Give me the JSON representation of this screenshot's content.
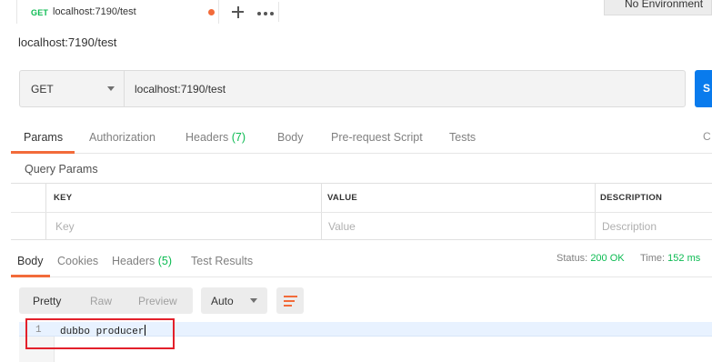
{
  "tab": {
    "method": "GET",
    "name": "localhost:7190/test"
  },
  "environment": {
    "label": "No Environment"
  },
  "request": {
    "title": "localhost:7190/test",
    "method": "GET",
    "url": "localhost:7190/test",
    "send_label": "S"
  },
  "request_tabs": [
    {
      "label": "Params",
      "active": true
    },
    {
      "label": "Authorization"
    },
    {
      "label": "Headers",
      "count": "(7)"
    },
    {
      "label": "Body"
    },
    {
      "label": "Pre-request Script"
    },
    {
      "label": "Tests"
    }
  ],
  "cookies_label": "C",
  "query_params": {
    "title": "Query Params",
    "columns": [
      "KEY",
      "VALUE",
      "DESCRIPTION"
    ],
    "placeholders": [
      "Key",
      "Value",
      "Description"
    ]
  },
  "response": {
    "tabs": [
      {
        "label": "Body",
        "active": true
      },
      {
        "label": "Cookies"
      },
      {
        "label": "Headers",
        "count": "(5)"
      },
      {
        "label": "Test Results"
      }
    ],
    "status_label": "Status:",
    "status_value": "200 OK",
    "time_label": "Time:",
    "time_value": "152 ms",
    "view_modes": [
      "Pretty",
      "Raw",
      "Preview"
    ],
    "format": "Auto",
    "lines": [
      {
        "number": "1",
        "text": "dubbo producer"
      }
    ]
  },
  "colors": {
    "accent": "#f26b3a",
    "success": "#0cbb52",
    "send": "#097bed",
    "annotation": "#e3202b"
  }
}
